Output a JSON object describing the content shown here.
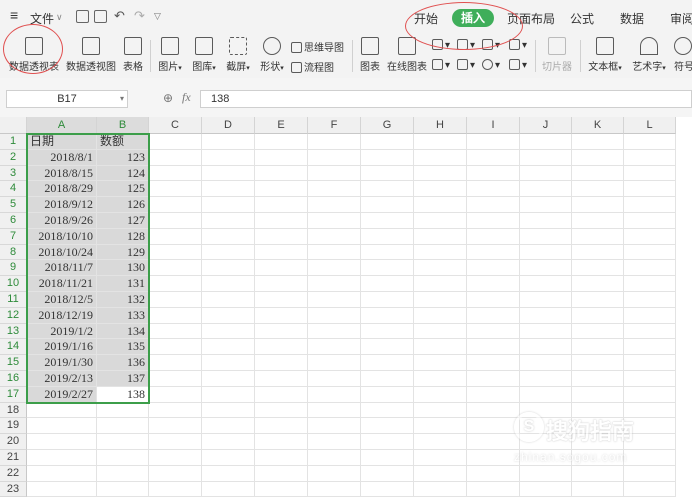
{
  "menubar": {
    "hamburger_label": "≡",
    "file_label": "文件",
    "tabs": [
      "开始",
      "插入",
      "页面布局",
      "公式",
      "数据",
      "审阅"
    ]
  },
  "ribbon": {
    "pivot_table": "数据透视表",
    "pivot_chart": "数据透视图",
    "table": "表格",
    "picture": "图片",
    "gallery": "图库",
    "screenshot": "截屏",
    "shapes": "形状",
    "mindmap": "思维导图",
    "flowchart": "流程图",
    "chart": "图表",
    "online_chart": "在线图表",
    "slicer": "切片器",
    "textbox": "文本框",
    "wordart": "艺术字",
    "symbol": "符号"
  },
  "formula_bar": {
    "cell_ref": "B17",
    "fx_label": "fx",
    "value": "138"
  },
  "grid": {
    "columns": [
      "A",
      "B",
      "C",
      "D",
      "E",
      "F",
      "G",
      "H",
      "I",
      "J",
      "K",
      "L"
    ],
    "rows": [
      "1",
      "2",
      "3",
      "4",
      "5",
      "6",
      "7",
      "8",
      "9",
      "10",
      "11",
      "12",
      "13",
      "14",
      "15",
      "16",
      "17",
      "18",
      "19",
      "20",
      "21",
      "22",
      "23"
    ],
    "header_row": [
      "日期",
      "数额"
    ],
    "data": [
      [
        "2018/8/1",
        "123"
      ],
      [
        "2018/8/15",
        "124"
      ],
      [
        "2018/8/29",
        "125"
      ],
      [
        "2018/9/12",
        "126"
      ],
      [
        "2018/9/26",
        "127"
      ],
      [
        "2018/10/10",
        "128"
      ],
      [
        "2018/10/24",
        "129"
      ],
      [
        "2018/11/7",
        "130"
      ],
      [
        "2018/11/21",
        "131"
      ],
      [
        "2018/12/5",
        "132"
      ],
      [
        "2018/12/19",
        "133"
      ],
      [
        "2019/1/2",
        "134"
      ],
      [
        "2019/1/16",
        "135"
      ],
      [
        "2019/1/30",
        "136"
      ],
      [
        "2019/2/13",
        "137"
      ],
      [
        "2019/2/27",
        "138"
      ]
    ]
  },
  "watermark": {
    "main": "搜狗指南",
    "sub": "zhinan.sogou.com",
    "logo": "S"
  },
  "colors": {
    "accent_green": "#3fae5a",
    "selection_border": "#3c9e4a",
    "annotation_red": "#e05050"
  }
}
